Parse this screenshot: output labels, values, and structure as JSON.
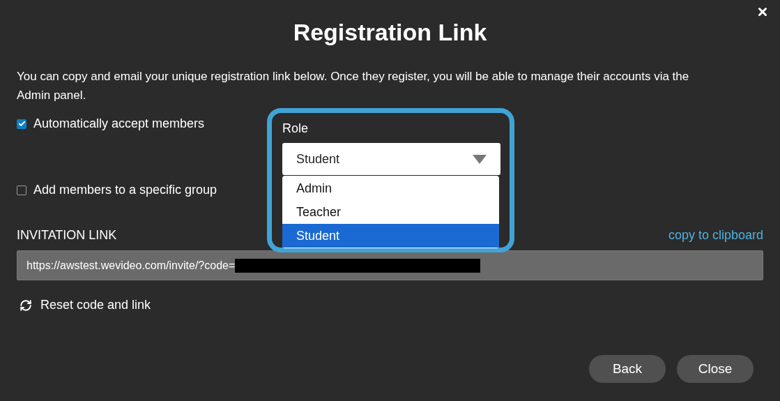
{
  "dialog": {
    "title": "Registration Link",
    "description": "You can copy and email your unique registration link below. Once they register, you will be able to manage their accounts via the Admin panel.",
    "options": [
      {
        "label": "Automatically accept members",
        "checked": true
      },
      {
        "label": "Add members to a specific group",
        "checked": false
      }
    ],
    "role": {
      "label": "Role",
      "value": "Student",
      "expanded": true,
      "options": [
        {
          "label": "Admin",
          "selected": false
        },
        {
          "label": "Teacher",
          "selected": false
        },
        {
          "label": "Student",
          "selected": true
        }
      ]
    },
    "invitation": {
      "label": "INVITATION LINK",
      "copy_link": "copy to clipboard",
      "url": "https://awstest.wevideo.com/invite/?code="
    },
    "reset_link": "Reset code and link",
    "buttons": [
      "Back",
      "Close"
    ]
  }
}
